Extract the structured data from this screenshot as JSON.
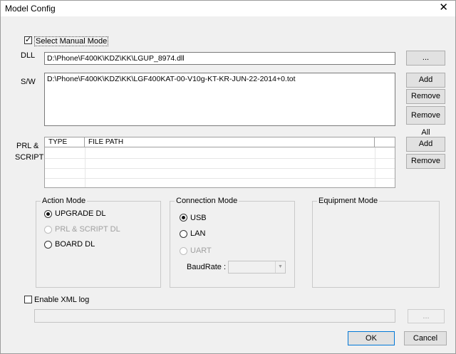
{
  "window": {
    "title": "Model Config"
  },
  "manual_mode": {
    "label": "Select Manual Mode",
    "checked": true
  },
  "dll": {
    "label": "DLL",
    "value": "D:\\Phone\\F400K\\KDZ\\KK\\LGUP_8974.dll",
    "browse_label": "..."
  },
  "sw": {
    "label": "S/W",
    "value": "D:\\Phone\\F400K\\KDZ\\KK\\LGF400KAT-00-V10g-KT-KR-JUN-22-2014+0.tot",
    "add_label": "Add",
    "remove_label": "Remove",
    "remove_all_label": "Remove All"
  },
  "prl": {
    "label_line1": "PRL   &",
    "label_line2": "SCRIPT",
    "columns": [
      "TYPE",
      "FILE PATH"
    ],
    "add_label": "Add",
    "remove_label": "Remove"
  },
  "action_mode": {
    "title": "Action Mode",
    "options": [
      {
        "label": "UPGRADE DL",
        "selected": true,
        "enabled": true
      },
      {
        "label": "PRL & SCRIPT DL",
        "selected": false,
        "enabled": false
      },
      {
        "label": "BOARD DL",
        "selected": false,
        "enabled": true
      }
    ]
  },
  "connection_mode": {
    "title": "Connection Mode",
    "options": [
      {
        "label": "USB",
        "selected": true,
        "enabled": true
      },
      {
        "label": "LAN",
        "selected": false,
        "enabled": true
      },
      {
        "label": "UART",
        "selected": false,
        "enabled": false
      }
    ],
    "baudrate_label": "BaudRate :",
    "baudrate_value": ""
  },
  "equipment_mode": {
    "title": "Equipment Mode"
  },
  "xml_log": {
    "label": "Enable XML log",
    "checked": false,
    "path_value": "",
    "browse_label": "..."
  },
  "footer": {
    "ok_label": "OK",
    "cancel_label": "Cancel"
  }
}
